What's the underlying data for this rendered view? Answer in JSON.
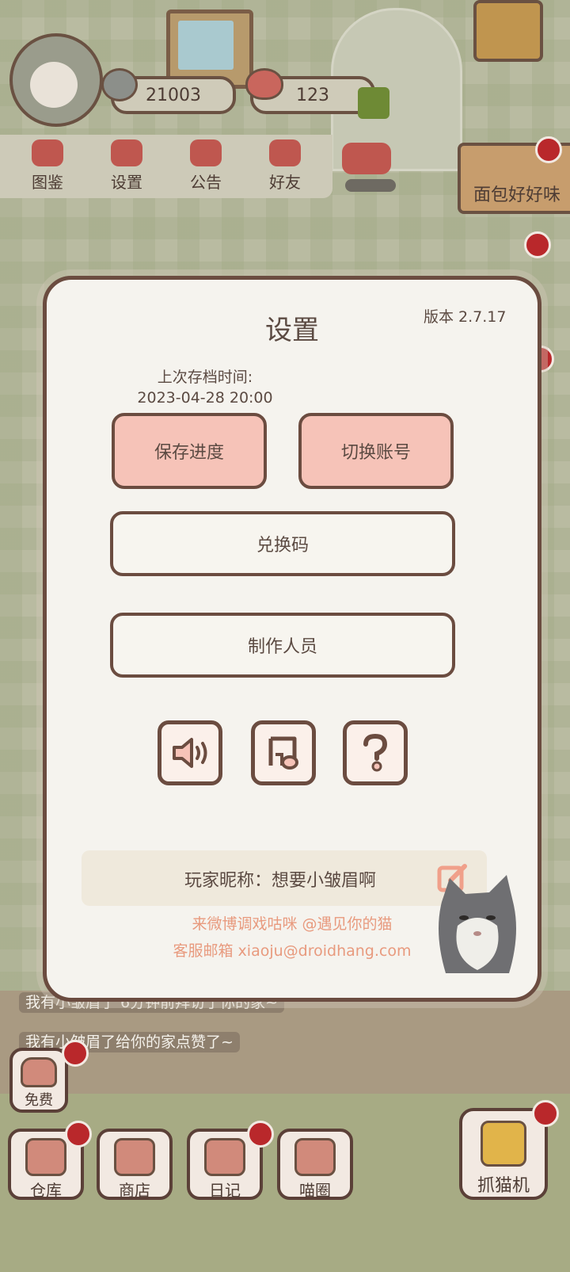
{
  "header": {
    "fish_count": "21003",
    "heart_count": "123"
  },
  "top_nav": [
    {
      "label": "图鉴",
      "icon": "cat-book-icon"
    },
    {
      "label": "设置",
      "icon": "gear-icon"
    },
    {
      "label": "公告",
      "icon": "gift-icon"
    },
    {
      "label": "好友",
      "icon": "friends-icon"
    }
  ],
  "side_sign": {
    "label": "面包好好味"
  },
  "dialog": {
    "title": "设置",
    "version": "版本 2.7.17",
    "last_save_label": "上次存档时间:",
    "last_save_time": "2023-04-28 20:00",
    "save_button": "保存进度",
    "switch_account_button": "切换账号",
    "redeem_code_button": "兑换码",
    "credits_button": "制作人员",
    "nickname_label": "玩家昵称：想要小皱眉啊",
    "weibo_text": "来微博调戏咕咪 @遇见你的猫",
    "email_text": "客服邮箱 xiaoju@droidhang.com",
    "icons": [
      "sound-icon",
      "music-icon",
      "help-icon"
    ]
  },
  "chat_lines": [
    "我有小皱眉了 6分钟前拜访了你的家~",
    "我有小皱眉了给你的家点赞了~"
  ],
  "bottom_bar": {
    "free": "免费",
    "warehouse": "仓库",
    "shop": "商店",
    "diary": "日记",
    "circle": "喵圈",
    "claw_machine": "抓猫机"
  },
  "colors": {
    "accent_pink": "#f6c3b8",
    "border_brown": "#6b4c40",
    "link_orange": "#e89a7e",
    "dialog_bg": "#f5f3ee"
  }
}
